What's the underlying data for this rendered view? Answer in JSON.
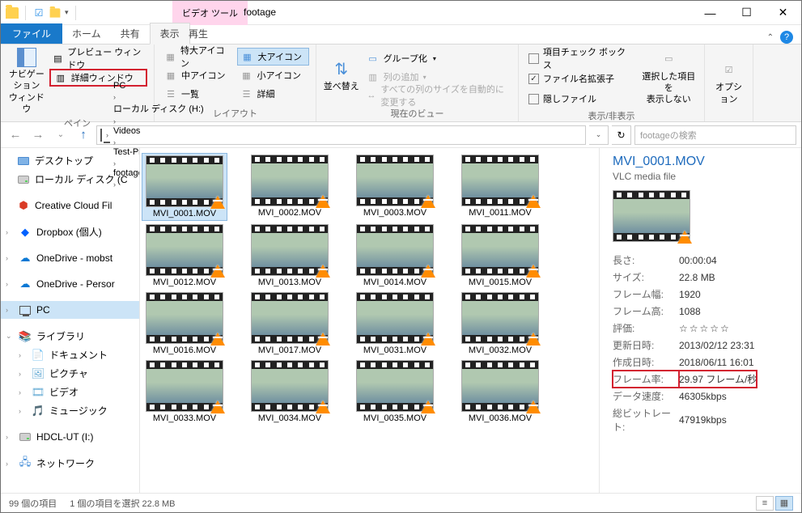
{
  "window": {
    "title": "footage",
    "context_tab": "ビデオ ツール"
  },
  "tabs": {
    "file": "ファイル",
    "home": "ホーム",
    "share": "共有",
    "view": "表示",
    "play": "再生"
  },
  "ribbon": {
    "pane_group": "ペイン",
    "nav_pane": "ナビゲーション\nウィンドウ",
    "preview_pane": "プレビュー ウィンドウ",
    "details_pane": "詳細ウィンドウ",
    "layout_group": "レイアウト",
    "xl_icons": "特大アイコン",
    "l_icons": "大アイコン",
    "m_icons": "中アイコン",
    "s_icons": "小アイコン",
    "list": "一覧",
    "details": "詳細",
    "current_view_group": "現在のビュー",
    "sort": "並べ替え",
    "group": "グループ化",
    "add_cols": "列の追加",
    "size_cols": "すべての列のサイズを自動的に変更する",
    "show_hide_group": "表示/非表示",
    "chk_boxes": "項目チェック ボックス",
    "ext": "ファイル名拡張子",
    "hidden": "隠しファイル",
    "hide_selected": "選択した項目を\n表示しない",
    "options": "オプション"
  },
  "breadcrumb": [
    "PC",
    "ローカル ディスク (H:)",
    "Videos",
    "Test-Project",
    "footage"
  ],
  "search_placeholder": "footageの検索",
  "sidebar": {
    "desktop": "デスクトップ",
    "local": "ローカル ディスク (C",
    "ccf": "Creative Cloud Fil",
    "dropbox": "Dropbox (個人)",
    "od1": "OneDrive - mobst",
    "od2": "OneDrive - Persor",
    "pc": "PC",
    "libraries": "ライブラリ",
    "documents": "ドキュメント",
    "pictures": "ピクチャ",
    "video": "ビデオ",
    "music": "ミュージック",
    "hdcl": "HDCL-UT (I:)",
    "network": "ネットワーク"
  },
  "files": [
    "MVI_0001.MOV",
    "MVI_0002.MOV",
    "MVI_0003.MOV",
    "MVI_0011.MOV",
    "MVI_0012.MOV",
    "MVI_0013.MOV",
    "MVI_0014.MOV",
    "MVI_0015.MOV",
    "MVI_0016.MOV",
    "MVI_0017.MOV",
    "MVI_0031.MOV",
    "MVI_0032.MOV",
    "MVI_0033.MOV",
    "MVI_0034.MOV",
    "MVI_0035.MOV",
    "MVI_0036.MOV"
  ],
  "details": {
    "title": "MVI_0001.MOV",
    "type": "VLC media file",
    "rows": [
      {
        "k": "長さ:",
        "v": "00:00:04"
      },
      {
        "k": "サイズ:",
        "v": "22.8 MB"
      },
      {
        "k": "フレーム幅:",
        "v": "1920"
      },
      {
        "k": "フレーム高:",
        "v": "1088"
      },
      {
        "k": "評価:",
        "v": "☆☆☆☆☆",
        "stars": true
      },
      {
        "k": "更新日時:",
        "v": "2013/02/12 23:31"
      },
      {
        "k": "作成日時:",
        "v": "2018/06/11 16:01"
      },
      {
        "k": "フレーム率:",
        "v": "29.97 フレーム/秒",
        "hl": true
      },
      {
        "k": "データ速度:",
        "v": "46305kbps"
      },
      {
        "k": "総ビットレート:",
        "v": "47919kbps"
      }
    ]
  },
  "status": {
    "count": "99 個の項目",
    "selection": "1 個の項目を選択 22.8 MB"
  }
}
